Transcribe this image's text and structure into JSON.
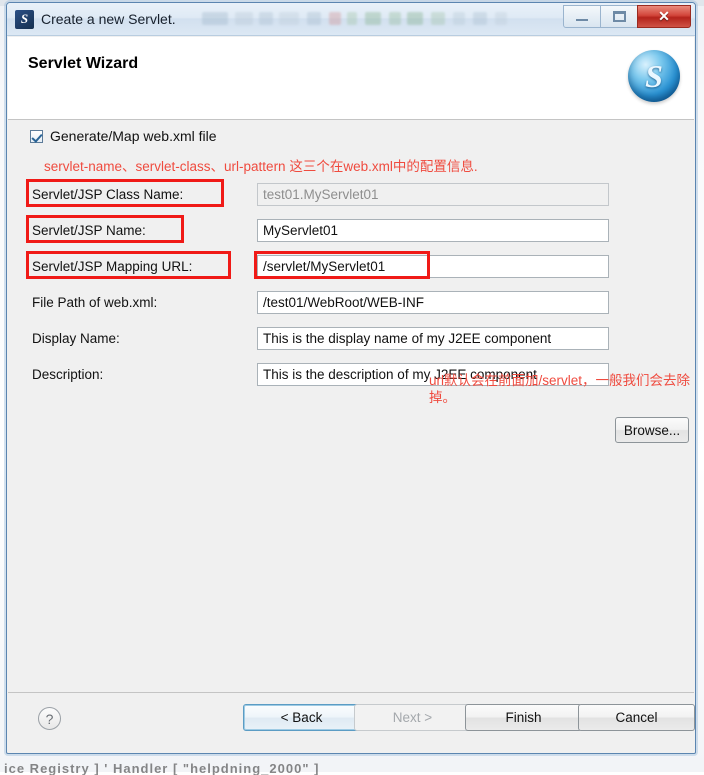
{
  "window": {
    "title": "Create a new Servlet.",
    "app_icon": "servlet-icon",
    "icon_letter": "S",
    "controls": {
      "minimize": "minimize-icon",
      "maximize": "maximize-icon",
      "close": "✕"
    }
  },
  "header": {
    "title": "Servlet Wizard",
    "logo_letter": "S"
  },
  "form": {
    "generate_checkbox_label": "Generate/Map web.xml file",
    "annotation_top": "servlet-name、servlet-class、url-pattern 这三个在web.xml中的配置信息.",
    "annotation_url": "url默认会在前面加/servlet，一般我们会去除掉。",
    "fields": [
      {
        "label": "Servlet/JSP Class Name:",
        "value": "test01.MyServlet01",
        "disabled": true
      },
      {
        "label": "Servlet/JSP Name:",
        "value": "MyServlet01",
        "disabled": false
      },
      {
        "label": "Servlet/JSP Mapping URL:",
        "value": "/servlet/MyServlet01",
        "disabled": false
      },
      {
        "label": "File Path of web.xml:",
        "value": "/test01/WebRoot/WEB-INF",
        "disabled": false
      },
      {
        "label": "Display Name:",
        "value": "This is the display name of my J2EE component",
        "disabled": false
      },
      {
        "label": "Description:",
        "value": "This is the description of my J2EE component",
        "disabled": false
      }
    ],
    "browse_button": "Browse..."
  },
  "footer": {
    "help": "?",
    "back": "< Back",
    "next": "Next >",
    "finish": "Finish",
    "cancel": "Cancel"
  },
  "background": {
    "bottom_text": "ice Registry ] ' Handler [ \"helpdning_2000\" ]"
  },
  "colors": {
    "annotation_red": "#ef4b3f",
    "box_red": "#f01a17",
    "close_red": "#d2453a",
    "accent_blue": "#5b9cc4"
  }
}
